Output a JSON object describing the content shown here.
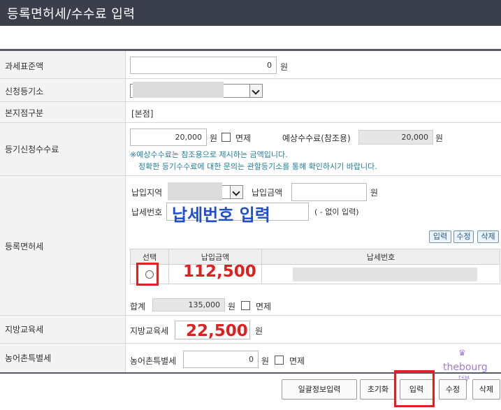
{
  "title": "등록면허세/수수료 입력",
  "rows": {
    "tax_base": {
      "label": "과세표준액",
      "value": "0",
      "unit": "원"
    },
    "registry": {
      "label": "신청등기소"
    },
    "branch": {
      "label": "본지점구분",
      "value": "[본점]"
    },
    "fee": {
      "label": "등기신청수수료",
      "value": "20,000",
      "unit": "원",
      "exempt_label": "면제",
      "expected_label": "예상수수료(참조용)",
      "expected_value": "20,000",
      "expected_unit": "원",
      "note1": "※예상수수료는 참조용으로 제시하는 금액입니다.",
      "note2": "정확한 등기수수료에 대한 문의는 관할등기소를 통해 확인하시기 바랍니다."
    },
    "license_tax": {
      "label": "등록면허세",
      "region_label": "납입지역",
      "amount_label": "납입금액",
      "amount_unit": "원",
      "taxno_label": "납세번호",
      "taxno_overlay": "납세번호 입력",
      "taxno_hint": "( - 없이 입력)",
      "buttons": [
        "입력",
        "수정",
        "삭제"
      ],
      "table_headers": [
        "선택",
        "납입금액",
        "납세번호"
      ],
      "row_amount": "112,500",
      "total_label": "합계",
      "total_value": "135,000",
      "total_unit": "원",
      "total_exempt_label": "면제"
    },
    "edu_tax": {
      "label": "지방교육세",
      "field_label": "지방교육세",
      "value": "22,500",
      "unit": "원"
    },
    "rural_tax": {
      "label": "농어촌특별세",
      "field_label": "농어촌특별세",
      "value": "0",
      "unit": "원",
      "exempt_label": "면제"
    }
  },
  "bottom_buttons": [
    "일괄정보입력",
    "초기화",
    "입력",
    "수정",
    "삭제"
  ],
  "watermark": {
    "main": "thebourg",
    "sub": "더부"
  },
  "colors": {
    "title_bg": "#3b3f4c",
    "highlight_red": "#e01f1f",
    "overlay_blue": "#1f4fd0",
    "note_teal": "#1f7f9a"
  }
}
